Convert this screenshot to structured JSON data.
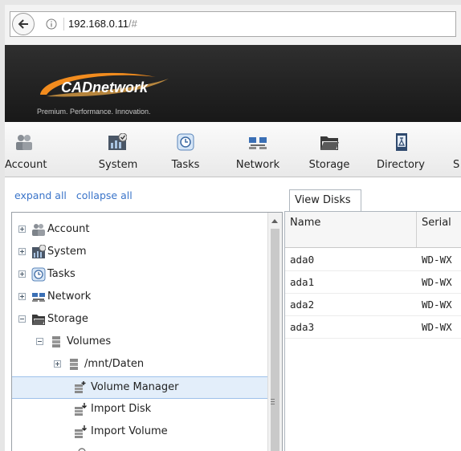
{
  "browser": {
    "url_host": "192.168.0.11",
    "url_path": "/#"
  },
  "header": {
    "logo_text": "CADnetwork",
    "tagline": "Premium. Performance. Innovation."
  },
  "toolbar": {
    "items": [
      {
        "label": "Account",
        "icon": "users-icon"
      },
      {
        "label": "System",
        "icon": "system-icon"
      },
      {
        "label": "Tasks",
        "icon": "clock-icon"
      },
      {
        "label": "Network",
        "icon": "network-icon"
      },
      {
        "label": "Storage",
        "icon": "folder-icon"
      },
      {
        "label": "Directory",
        "icon": "directory-icon"
      },
      {
        "label": "S"
      }
    ]
  },
  "sidebar": {
    "expand_all": "expand all",
    "collapse_all": "collapse all",
    "tree": [
      {
        "label": "Account"
      },
      {
        "label": "System"
      },
      {
        "label": "Tasks"
      },
      {
        "label": "Network"
      },
      {
        "label": "Storage"
      },
      {
        "label": "Volumes"
      },
      {
        "label": "/mnt/Daten"
      },
      {
        "label": "Volume Manager",
        "selected": true
      },
      {
        "label": "Import Disk"
      },
      {
        "label": "Import Volume"
      }
    ]
  },
  "main": {
    "tab_label": "View Disks",
    "columns": [
      "Name",
      "Serial"
    ],
    "rows": [
      {
        "name": "ada0",
        "serial": "WD-WX"
      },
      {
        "name": "ada1",
        "serial": "WD-WX"
      },
      {
        "name": "ada2",
        "serial": "WD-WX"
      },
      {
        "name": "ada3",
        "serial": "WD-WX"
      }
    ]
  },
  "colors": {
    "link": "#3a74c9",
    "logo_orange": "#f28c1e",
    "header_bg": "#1f1f1f",
    "selection": "#e3eefa"
  }
}
